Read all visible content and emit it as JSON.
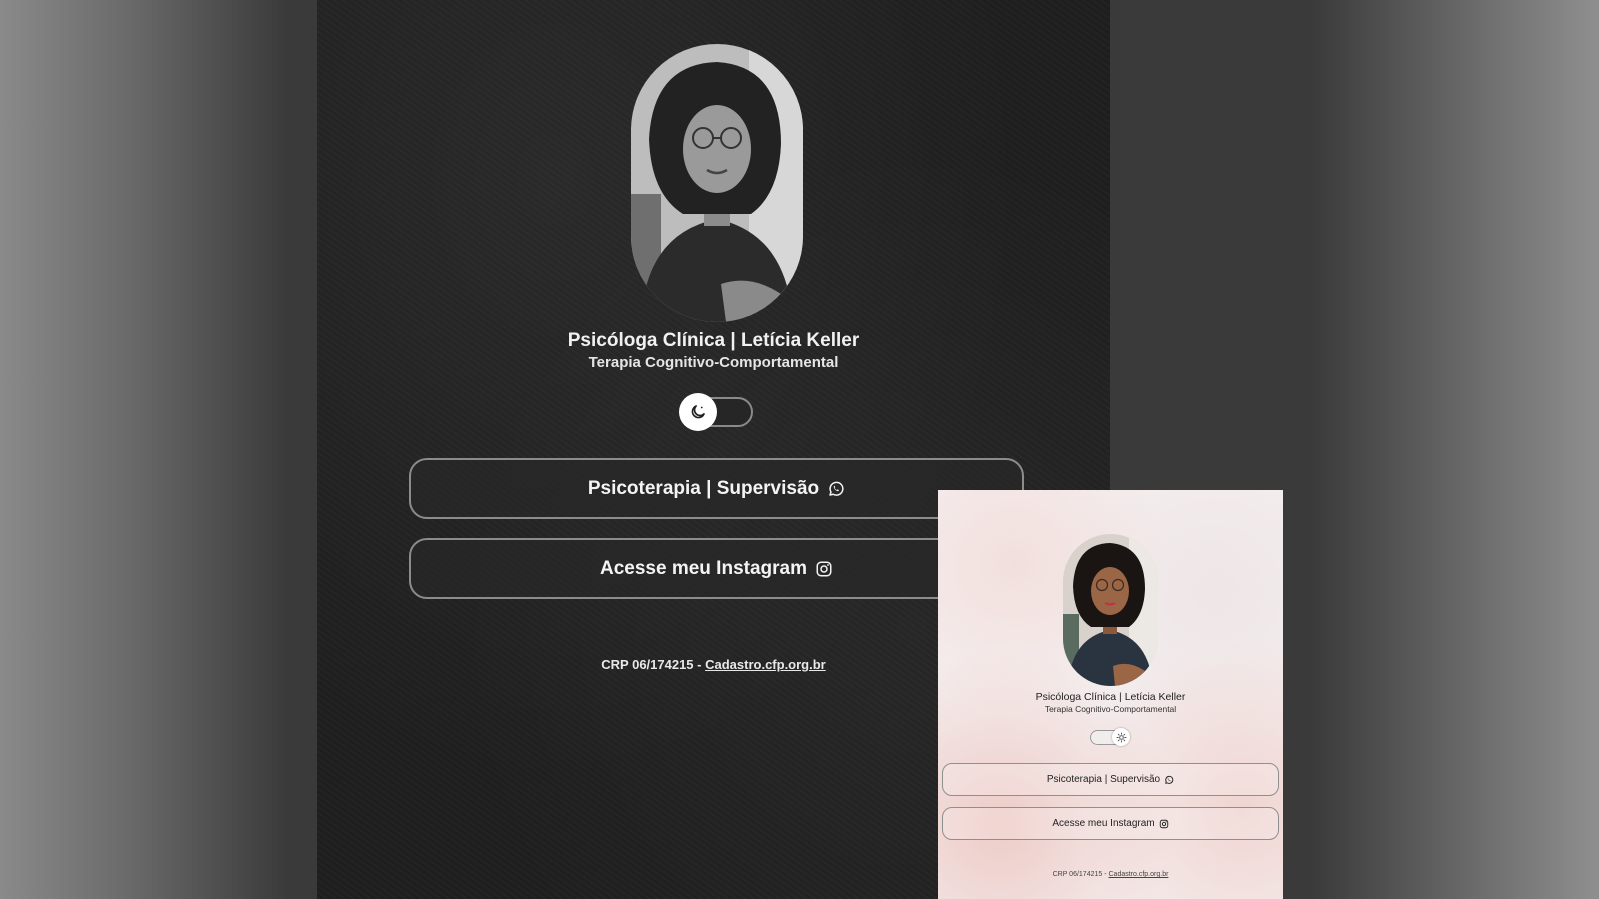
{
  "dark": {
    "title": "Psicóloga Clínica | Letícia Keller",
    "subtitle": "Terapia Cognitivo-Comportamental",
    "theme_toggle_icon": "moon-icon",
    "buttons": [
      {
        "label": "Psicoterapia | Supervisão",
        "icon": "whatsapp-icon"
      },
      {
        "label": "Acesse meu Instagram",
        "icon": "instagram-icon"
      }
    ],
    "footer_text": "CRP 06/174215 - ",
    "footer_link": "Cadastro.cfp.org.br"
  },
  "light": {
    "title": "Psicóloga Clínica | Letícia Keller",
    "subtitle": "Terapia Cognitivo-Comportamental",
    "theme_toggle_icon": "sun-icon",
    "buttons": [
      {
        "label": "Psicoterapia | Supervisão",
        "icon": "whatsapp-icon"
      },
      {
        "label": "Acesse meu Instagram",
        "icon": "instagram-icon"
      }
    ],
    "footer_text": "CRP 06/174215 - ",
    "footer_link": "Cadastro.cfp.org.br"
  },
  "colors": {
    "dark_background": "#1f1f1f",
    "light_background": "#f4eeee",
    "accent_blush": "#e8b0a8"
  }
}
